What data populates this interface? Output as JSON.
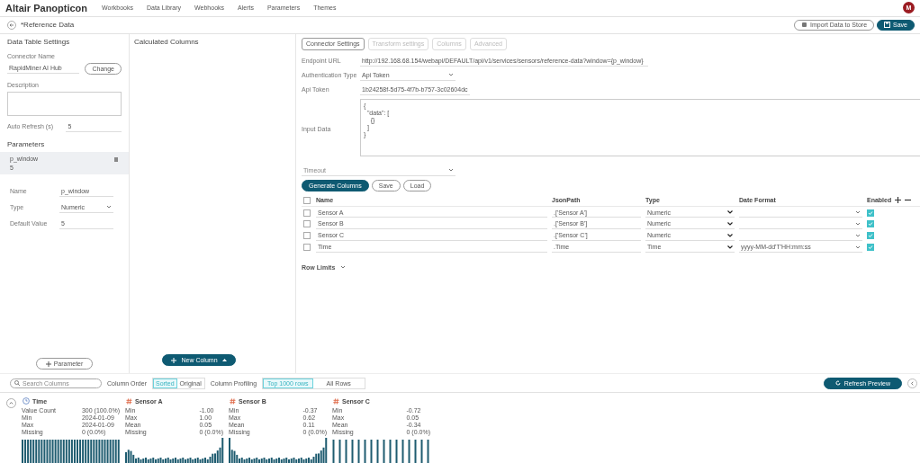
{
  "app": {
    "logo": "Altair Panopticon",
    "nav": [
      "Workbooks",
      "Data Library",
      "Webhooks",
      "Alerts",
      "Parameters",
      "Themes"
    ],
    "avatar": "M"
  },
  "header": {
    "title": "*Reference Data",
    "import_button": "Import Data to Store",
    "save_button": "Save"
  },
  "settings": {
    "heading": "Data Table Settings",
    "connector_label": "Connector Name",
    "connector_value": "RapidMiner AI Hub",
    "change_button": "Change",
    "description_label": "Description",
    "auto_refresh_label": "Auto Refresh (s)",
    "auto_refresh_value": "5",
    "parameters_heading": "Parameters",
    "parameters": [
      {
        "name": "p_window",
        "value": "5",
        "selected": true
      }
    ],
    "fields": [
      {
        "label": "Name",
        "value": "p_window",
        "kind": "text"
      },
      {
        "label": "Type",
        "value": "Numeric",
        "kind": "select"
      },
      {
        "label": "Default Value",
        "value": "5",
        "kind": "text"
      }
    ],
    "add_button": "Parameter"
  },
  "calculated": {
    "heading": "Calculated Columns",
    "new_button": "New Column"
  },
  "connector": {
    "tabs": [
      {
        "label": "Connector Settings",
        "selected": true
      },
      {
        "label": "Transform settings",
        "selected": false
      },
      {
        "label": "Columns",
        "selected": false
      },
      {
        "label": "Advanced",
        "selected": false
      }
    ],
    "fields": [
      {
        "label": "Endpoint URL",
        "value": "http://192.168.68.154/webapi/DEFAULT/api/v1/services/sensors/reference-data?window={p_window}",
        "kind": "url"
      },
      {
        "label": "Authentication Type",
        "value": "Api Token",
        "kind": "select"
      },
      {
        "label": "Api Token",
        "value": "1b24258f-5d75-4f7b-b757-3c02604dc",
        "kind": "text"
      },
      {
        "label": "Input Data",
        "value": "{\n  \"data\": [\n    {}\n  ]\n}",
        "kind": "textarea"
      },
      {
        "label": "Timeout",
        "kind": "select"
      }
    ],
    "buttons": [
      "Generate Columns",
      "Save",
      "Load"
    ],
    "select_all_checked": false,
    "table_headers": [
      "Name",
      "JsonPath",
      "Type",
      "Date Format",
      "Enabled"
    ],
    "columns": [
      {
        "name": "Sensor A",
        "path": ".['Sensor A']",
        "type": "Numeric",
        "checked": false,
        "enabled": true
      },
      {
        "name": "Sensor B",
        "path": ".['Sensor B']",
        "type": "Numeric",
        "checked": false,
        "enabled": true
      },
      {
        "name": "Sensor C",
        "path": ".['Sensor C']",
        "type": "Numeric",
        "checked": false,
        "enabled": true
      },
      {
        "name": "Time",
        "path": ".Time",
        "type": "Time",
        "date_format": "yyyy-MM-dd'T'HH:mm:ss",
        "checked": false,
        "enabled": true
      }
    ],
    "row_limits": "Row Limits"
  },
  "preview": {
    "search_placeholder": "Search Columns",
    "order_label": "Column Order",
    "order": [
      {
        "label": "Sorted",
        "selected": true
      },
      {
        "label": "Original",
        "selected": false
      }
    ],
    "profiling_label": "Column Profiling",
    "profiling": [
      {
        "label": "Top 1000 rows",
        "selected": true
      },
      {
        "label": "All Rows",
        "selected": false
      }
    ],
    "refresh_button": "Refresh Preview",
    "profiles": [
      {
        "name": "Time",
        "kind": "time",
        "stats": [
          [
            "Value Count",
            "300 (100.0%)"
          ],
          [
            "Min",
            "2024-01-09"
          ],
          [
            "Max",
            "2024-01-09"
          ],
          [
            "Missing",
            "0 (0.0%)"
          ]
        ]
      },
      {
        "name": "Sensor A",
        "kind": "numeric",
        "stats": [
          [
            "Min",
            "-1.00"
          ],
          [
            "Max",
            "1.00"
          ],
          [
            "Mean",
            "0.05"
          ],
          [
            "Missing",
            "0 (0.0%)"
          ]
        ]
      },
      {
        "name": "Sensor B",
        "kind": "numeric",
        "stats": [
          [
            "Min",
            "-0.37"
          ],
          [
            "Max",
            "0.62"
          ],
          [
            "Mean",
            "0.11"
          ],
          [
            "Missing",
            "0 (0.0%)"
          ]
        ]
      },
      {
        "name": "Sensor C",
        "kind": "numeric",
        "stats": [
          [
            "Min",
            "-0.72"
          ],
          [
            "Max",
            "0.05"
          ],
          [
            "Mean",
            "-0.34"
          ],
          [
            "Missing",
            "0 (0.0%)"
          ]
        ]
      }
    ]
  }
}
